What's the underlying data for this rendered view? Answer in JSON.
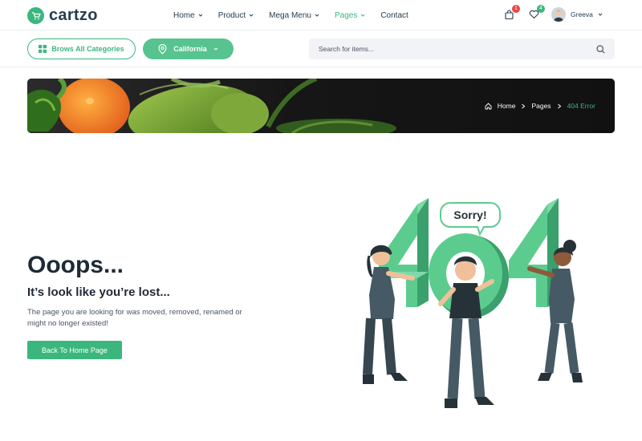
{
  "brand": {
    "name": "cartzo",
    "color": "#3bb77e"
  },
  "nav": {
    "items": [
      {
        "label": "Home",
        "caret": true,
        "active": false
      },
      {
        "label": "Product",
        "caret": true,
        "active": false
      },
      {
        "label": "Mega Menu",
        "caret": true,
        "active": false
      },
      {
        "label": "Pages",
        "caret": true,
        "active": true
      },
      {
        "label": "Contact",
        "caret": false,
        "active": false
      }
    ]
  },
  "header": {
    "cart_count": "1",
    "wishlist_count": "4",
    "user_name": "Greeva"
  },
  "subbar": {
    "categories_label": "Brows All Categories",
    "location_label": "California",
    "search_placeholder": "Search for items..."
  },
  "breadcrumb": {
    "home": "Home",
    "pages": "Pages",
    "current": "404 Error"
  },
  "error": {
    "title": "Ooops...",
    "subtitle": "It’s look like you’re lost...",
    "description": "The page you are looking for was moved, removed, renamed or might no longer existed!",
    "button": "Back To Home Page"
  },
  "illustration": {
    "bubble_text": "Sorry!",
    "digits": "404"
  }
}
